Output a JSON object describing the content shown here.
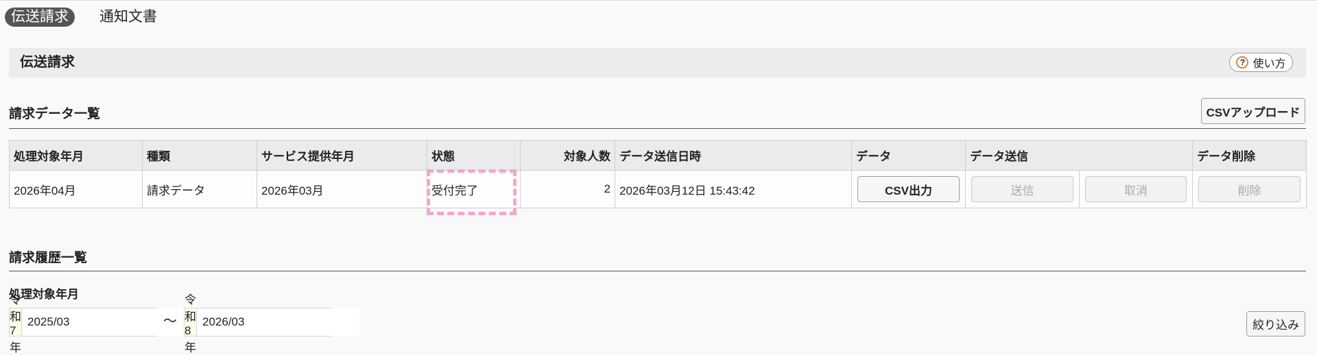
{
  "tabs": [
    {
      "label": "伝送請求",
      "active": true
    },
    {
      "label": "通知文書",
      "active": false
    }
  ],
  "header": {
    "title": "伝送請求",
    "help_label": "使い方",
    "help_icon": "question-circle-icon",
    "help_icon_glyph": "?"
  },
  "billing_list": {
    "heading": "請求データ一覧",
    "upload_label": "CSVアップロード",
    "columns": [
      "処理対象年月",
      "種類",
      "サービス提供年月",
      "状態",
      "対象人数",
      "データ送信日時",
      "データ",
      "データ送信",
      "データ削除"
    ],
    "rows": [
      {
        "period": "2026年04月",
        "type": "請求データ",
        "service_month": "2026年03月",
        "status": "受付完了",
        "count": "2",
        "sent_at": "2026年03月12日 15:43:42",
        "csv_label": "CSV出力",
        "send_label": "送信",
        "cancel_label": "取消",
        "delete_label": "削除"
      }
    ]
  },
  "history": {
    "heading": "請求履歴一覧",
    "filter_label": "処理対象年月",
    "from": {
      "era": "令和7年",
      "value": "2025/03"
    },
    "separator": "〜",
    "to": {
      "era": "令和8年",
      "value": "2026/03"
    },
    "filter_button": "絞り込み"
  },
  "colors": {
    "tab_active_bg": "#555555",
    "help_icon": "#e0813a",
    "highlight": "#f3a6cf",
    "date_label_bg": "#fffbe8"
  }
}
